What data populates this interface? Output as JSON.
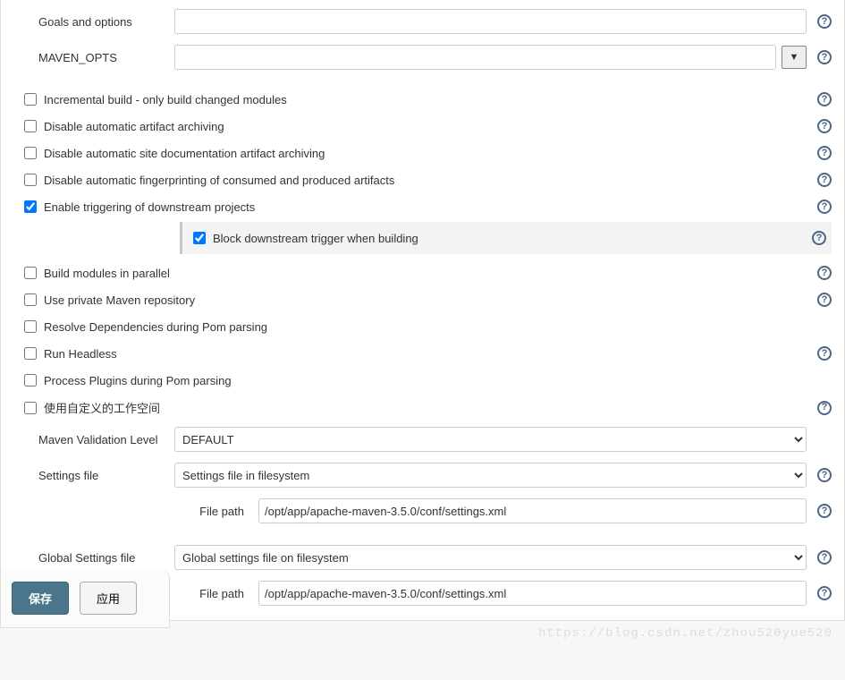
{
  "labels": {
    "goals": "Goals and options",
    "maven_opts": "MAVEN_OPTS",
    "maven_validation_level": "Maven Validation Level",
    "settings_file": "Settings file",
    "global_settings_file": "Global Settings file",
    "file_path": "File path"
  },
  "values": {
    "goals": "",
    "maven_opts": "",
    "maven_validation_level": "DEFAULT",
    "settings_file": "Settings file in filesystem",
    "settings_file_path": "/opt/app/apache-maven-3.5.0/conf/settings.xml",
    "global_settings_file": "Global settings file on filesystem",
    "global_settings_file_path": "/opt/app/apache-maven-3.5.0/conf/settings.xml"
  },
  "checks": {
    "incremental_build": {
      "label": "Incremental build - only build changed modules",
      "checked": false
    },
    "disable_artifact_archiving": {
      "label": "Disable automatic artifact archiving",
      "checked": false
    },
    "disable_site_archiving": {
      "label": "Disable automatic site documentation artifact archiving",
      "checked": false
    },
    "disable_fingerprinting": {
      "label": "Disable automatic fingerprinting of consumed and produced artifacts",
      "checked": false
    },
    "enable_downstream": {
      "label": "Enable triggering of downstream projects",
      "checked": true
    },
    "block_downstream": {
      "label": "Block downstream trigger when building",
      "checked": true
    },
    "build_parallel": {
      "label": "Build modules in parallel",
      "checked": false
    },
    "use_private_repo": {
      "label": "Use private Maven repository",
      "checked": false
    },
    "resolve_deps_pom": {
      "label": "Resolve Dependencies during Pom parsing",
      "checked": false
    },
    "run_headless": {
      "label": "Run Headless",
      "checked": false
    },
    "process_plugins_pom": {
      "label": "Process Plugins during Pom parsing",
      "checked": false
    },
    "custom_workspace": {
      "label": "使用自定义的工作空间",
      "checked": false
    }
  },
  "buttons": {
    "save": "保存",
    "apply": "应用"
  },
  "icons": {
    "help": "?",
    "expand": "▼"
  },
  "watermark": "https://blog.csdn.net/zhou520yue520"
}
